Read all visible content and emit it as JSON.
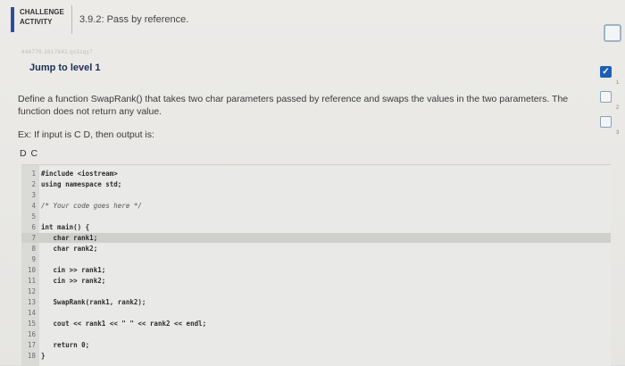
{
  "header": {
    "badge_line1": "CHALLENGE",
    "badge_line2": "ACTIVITY",
    "activity_title": "3.9.2: Pass by reference."
  },
  "faint_id": "444776.1617842.qx3zqy7",
  "jump_level": "Jump to level 1",
  "description": "Define a function SwapRank() that takes two char parameters passed by reference and swaps the values in the two parameters. The function does not return any value.",
  "example": "Ex: If input is C D, then output is:",
  "output_sample": "D C",
  "levels": [
    {
      "num": "1",
      "done": true,
      "mark": "✓"
    },
    {
      "num": "2",
      "done": false,
      "mark": ""
    },
    {
      "num": "3",
      "done": false,
      "mark": ""
    }
  ],
  "code_lines": [
    {
      "n": "1",
      "text": "#include <iostream>",
      "comment": false,
      "hl": false
    },
    {
      "n": "2",
      "text": "using namespace std;",
      "comment": false,
      "hl": false
    },
    {
      "n": "3",
      "text": "",
      "comment": false,
      "hl": false
    },
    {
      "n": "4",
      "text": "/* Your code goes here */",
      "comment": true,
      "hl": false
    },
    {
      "n": "5",
      "text": "",
      "comment": false,
      "hl": false
    },
    {
      "n": "6",
      "text": "int main() {",
      "comment": false,
      "hl": false
    },
    {
      "n": "7",
      "text": "   char rank1;",
      "comment": false,
      "hl": true
    },
    {
      "n": "8",
      "text": "   char rank2;",
      "comment": false,
      "hl": false
    },
    {
      "n": "9",
      "text": "",
      "comment": false,
      "hl": false
    },
    {
      "n": "10",
      "text": "   cin >> rank1;",
      "comment": false,
      "hl": false
    },
    {
      "n": "11",
      "text": "   cin >> rank2;",
      "comment": false,
      "hl": false
    },
    {
      "n": "12",
      "text": "",
      "comment": false,
      "hl": false
    },
    {
      "n": "13",
      "text": "   SwapRank(rank1, rank2);",
      "comment": false,
      "hl": false
    },
    {
      "n": "14",
      "text": "",
      "comment": false,
      "hl": false
    },
    {
      "n": "15",
      "text": "   cout << rank1 << \" \" << rank2 << endl;",
      "comment": false,
      "hl": false
    },
    {
      "n": "16",
      "text": "",
      "comment": false,
      "hl": false
    },
    {
      "n": "17",
      "text": "   return 0;",
      "comment": false,
      "hl": false
    },
    {
      "n": "18",
      "text": "}",
      "comment": false,
      "hl": false
    }
  ]
}
